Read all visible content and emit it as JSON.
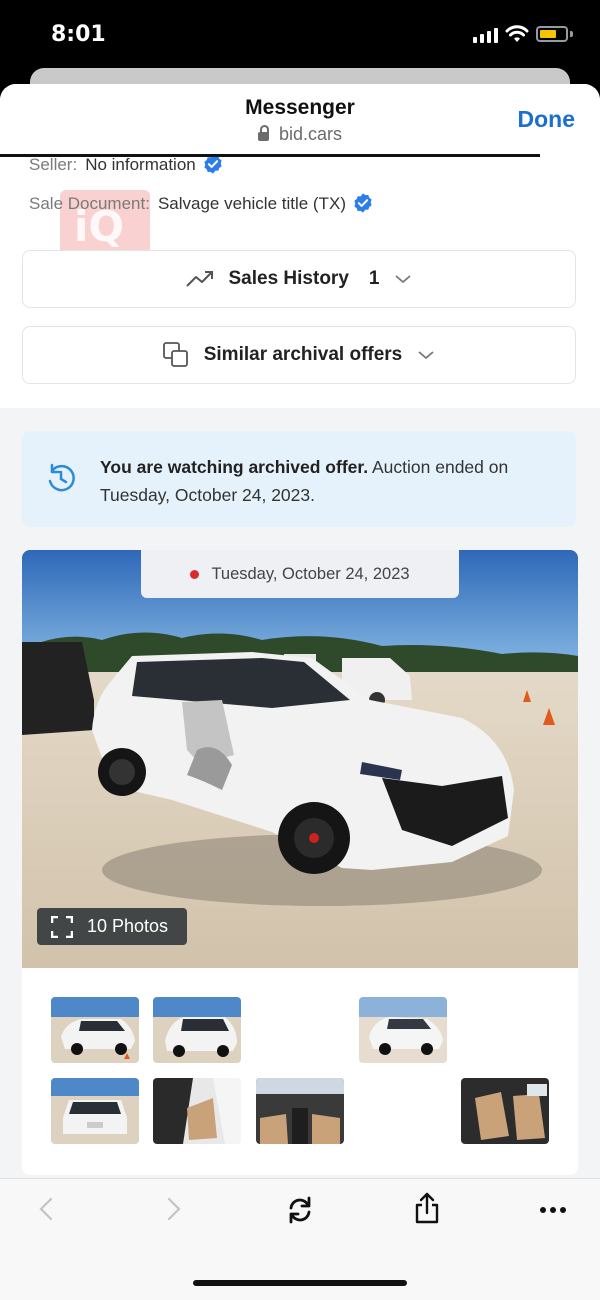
{
  "status_bar": {
    "time": "8:01"
  },
  "header": {
    "title": "Messenger",
    "url": "bid.cars",
    "done_label": "Done"
  },
  "watermark": {
    "text": "iQ"
  },
  "details": {
    "seller_label": "Seller:",
    "seller_value": "No information",
    "doc_label": "Sale Document:",
    "doc_value": "Salvage vehicle title (TX)"
  },
  "accordions": {
    "sales_history_label": "Sales History",
    "sales_history_count": "1",
    "similar_label": "Similar archival offers"
  },
  "notice": {
    "bold": "You are watching archived offer.",
    "rest": " Auction ended on Tuesday, October 24, 2023."
  },
  "gallery": {
    "date": "Tuesday, October 24, 2023",
    "photos_label": "10 Photos"
  },
  "colors": {
    "accent": "#1a6fd1",
    "verified": "#2b7de9",
    "notice_bg": "#e6f2fb",
    "battery": "#f5c400"
  }
}
